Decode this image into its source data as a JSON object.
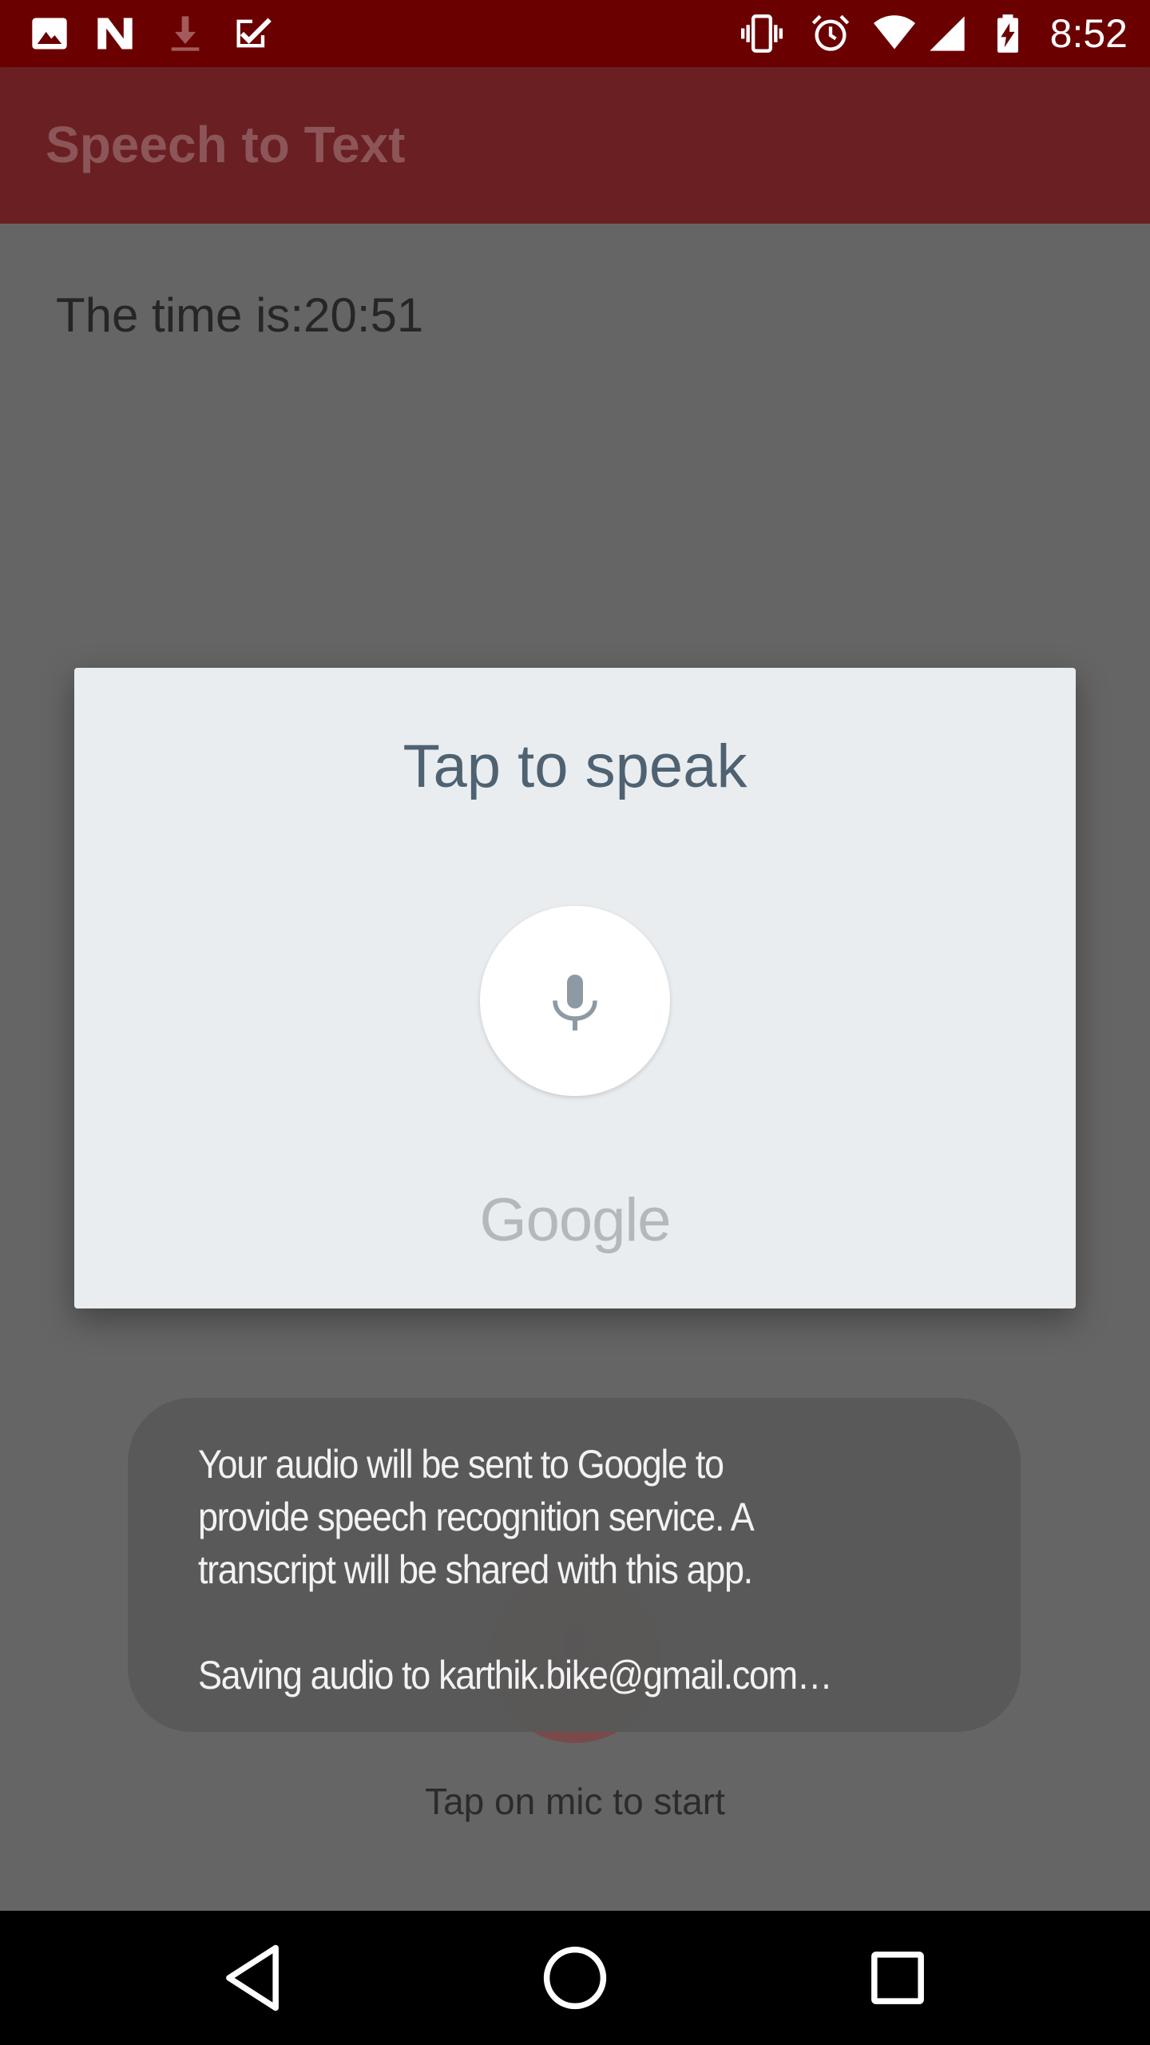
{
  "status_bar": {
    "time": "8:52",
    "left_icons": [
      "image-notification-icon",
      "n-notification-icon",
      "download-icon",
      "task-check-icon"
    ],
    "right_icons": [
      "vibrate-icon",
      "alarm-icon",
      "wifi-icon",
      "signal-icon",
      "battery-charging-icon"
    ]
  },
  "app_bar": {
    "title": "Speech to Text"
  },
  "content": {
    "time_text": "The time is:20:51",
    "hint_text": "Tap on mic to start"
  },
  "dialog": {
    "title": "Tap to speak",
    "mic_icon": "microphone-icon",
    "logo_text": "Google"
  },
  "toast": {
    "line1": "Your audio will be sent to Google to",
    "line2": "provide speech recognition service. A",
    "line3": "transcript will be shared with this app.",
    "line4": "Saving audio to karthik.bike@gmail.com…"
  },
  "nav_bar": {
    "buttons": [
      "back-icon",
      "home-icon",
      "recents-icon"
    ]
  },
  "colors": {
    "status_bar": "#6b0000",
    "app_bar": "#6a1f23",
    "scrim_content": "#656565",
    "dialog_bg": "#e9edf0",
    "dialog_title": "#4f6272",
    "toast_bg": "#585858",
    "nav_bar": "#000000"
  }
}
